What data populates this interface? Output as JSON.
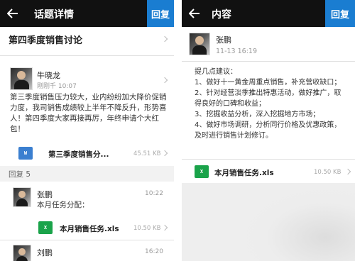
{
  "left": {
    "header": {
      "title": "话题详情",
      "reply_label": "回复"
    },
    "topic_title": "第四季度销售讨论",
    "post": {
      "author": "牛晓龙",
      "time": "刚刚千 10:07",
      "body": "第三季度销售压力较大，业内纷纷加大降价促销力度，我司销售成绩较上半年不降反升，形势喜人！第四季度大家再接再厉，年终申请个大红包！",
      "attachment": {
        "name": "第三季度销售分...",
        "size": "45.51 KB",
        "icon_text": "W"
      }
    },
    "reply_section": {
      "label": "回复 5"
    },
    "replies": [
      {
        "author": "张鹏",
        "time": "10:22",
        "text": "本月任务分配：",
        "attachment": {
          "name": "本月销售任务.xls",
          "size": "10.50 KB",
          "icon_text": "X"
        }
      },
      {
        "author": "刘鹏",
        "time": "16:20"
      }
    ]
  },
  "right": {
    "header": {
      "title": "内容",
      "reply_label": "回复"
    },
    "post": {
      "author": "张鹏",
      "time": "11-13 16:19",
      "body_lines": [
        "提几点建议：",
        "1、做好十一黄金周重点销售，补充营收缺口；",
        "2、针对经营淡季推出特惠活动，做好推广，取得良好的口碑和收益；",
        "3、挖掘收益分析，深入挖掘地方市场；",
        "4、做好市场调研，分析同行价格及优惠政策，及时进行销售计划修订。"
      ],
      "attachment": {
        "name": "本月销售任务.xls",
        "size": "10.50 KB",
        "icon_text": "X"
      }
    }
  },
  "colors": {
    "topbar": "#111111",
    "accent": "#1a7dd1",
    "excel": "#1aa34a",
    "word": "#3b7fd0"
  }
}
